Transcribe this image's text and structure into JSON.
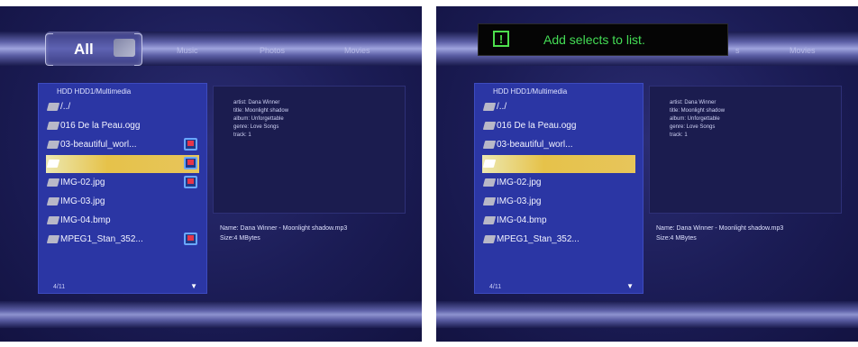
{
  "tabs": {
    "active": "All",
    "others": [
      "Music",
      "Photos",
      "Movies"
    ]
  },
  "file_browser": {
    "path": "HDD  HDD1/Multimedia",
    "items": [
      {
        "label": "/../",
        "marked": false,
        "selected": false
      },
      {
        "label": "016 De la Peau.ogg",
        "marked": false,
        "selected": false
      },
      {
        "label": "03-beautiful_worl...",
        "marked": true,
        "selected": false
      },
      {
        "label": "",
        "marked": true,
        "selected": true
      },
      {
        "label": "IMG-02.jpg",
        "marked": true,
        "selected": false
      },
      {
        "label": "IMG-03.jpg",
        "marked": false,
        "selected": false
      },
      {
        "label": "IMG-04.bmp",
        "marked": false,
        "selected": false
      },
      {
        "label": "MPEG1_Stan_352...",
        "marked": true,
        "selected": false
      }
    ],
    "page": "4/11"
  },
  "info": {
    "artist": "artist: Dana Winner",
    "title": "title: Moonlight shadow",
    "album": "album: Unforgettable",
    "genre": "genre: Love Songs",
    "track": "track: 1",
    "name": "Name: Dana Winner - Moonlight shadow.mp3",
    "size": "Size:4 MBytes"
  },
  "toast": {
    "icon": "exclamation-icon",
    "text": "Add selects to list."
  },
  "colors": {
    "panel": "#2b36a4",
    "selection": "#e6c24a",
    "toast_text": "#44dd55"
  }
}
